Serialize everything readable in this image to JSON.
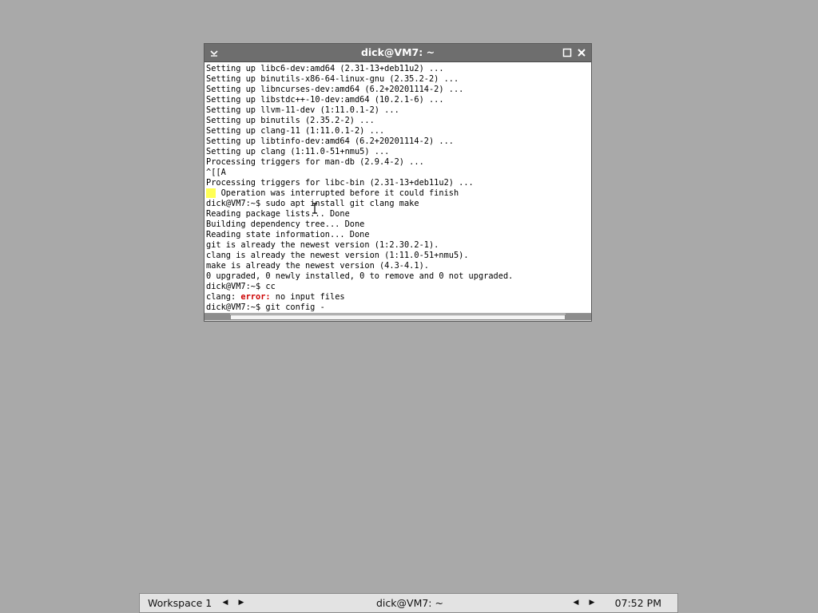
{
  "window": {
    "title": "dick@VM7: ~",
    "menu_glyph": "⌄",
    "maximize_glyph": "☐",
    "close_glyph": "✕"
  },
  "terminal": {
    "lines": [
      "Setting up libc6-dev:amd64 (2.31-13+deb11u2) ...",
      "Setting up binutils-x86-64-linux-gnu (2.35.2-2) ...",
      "Setting up libncurses-dev:amd64 (6.2+20201114-2) ...",
      "Setting up libstdc++-10-dev:amd64 (10.2.1-6) ...",
      "Setting up llvm-11-dev (1:11.0.1-2) ...",
      "Setting up binutils (2.35.2-2) ...",
      "Setting up clang-11 (1:11.0.1-2) ...",
      "Setting up libtinfo-dev:amd64 (6.2+20201114-2) ...",
      "Setting up clang (1:11.0-51+nmu5) ...",
      "Processing triggers for man-db (2.9.4-2) ...",
      "^[[A",
      "Processing triggers for libc-bin (2.31-13+deb11u2) ..."
    ],
    "warning_mark": "W:",
    "warning_text": " Operation was interrupted before it could finish",
    "lines2": [
      "dick@VM7:~$ sudo apt install git clang make",
      "Reading package lists... Done",
      "Building dependency tree... Done",
      "Reading state information... Done",
      "git is already the newest version (1:2.30.2-1).",
      "clang is already the newest version (1:11.0-51+nmu5).",
      "make is already the newest version (4.3-4.1).",
      "0 upgraded, 0 newly installed, 0 to remove and 0 not upgraded.",
      "dick@VM7:~$ cc"
    ],
    "clang_prefix": "clang: ",
    "clang_error": "error:",
    "clang_suffix": " no input files",
    "prompt_line": "dick@VM7:~$ git config -"
  },
  "taskbar": {
    "workspace": "Workspace 1",
    "task": "dick@VM7: ~",
    "clock": "07:52 PM",
    "left_arrow": "◀",
    "right_arrow": "▶"
  }
}
